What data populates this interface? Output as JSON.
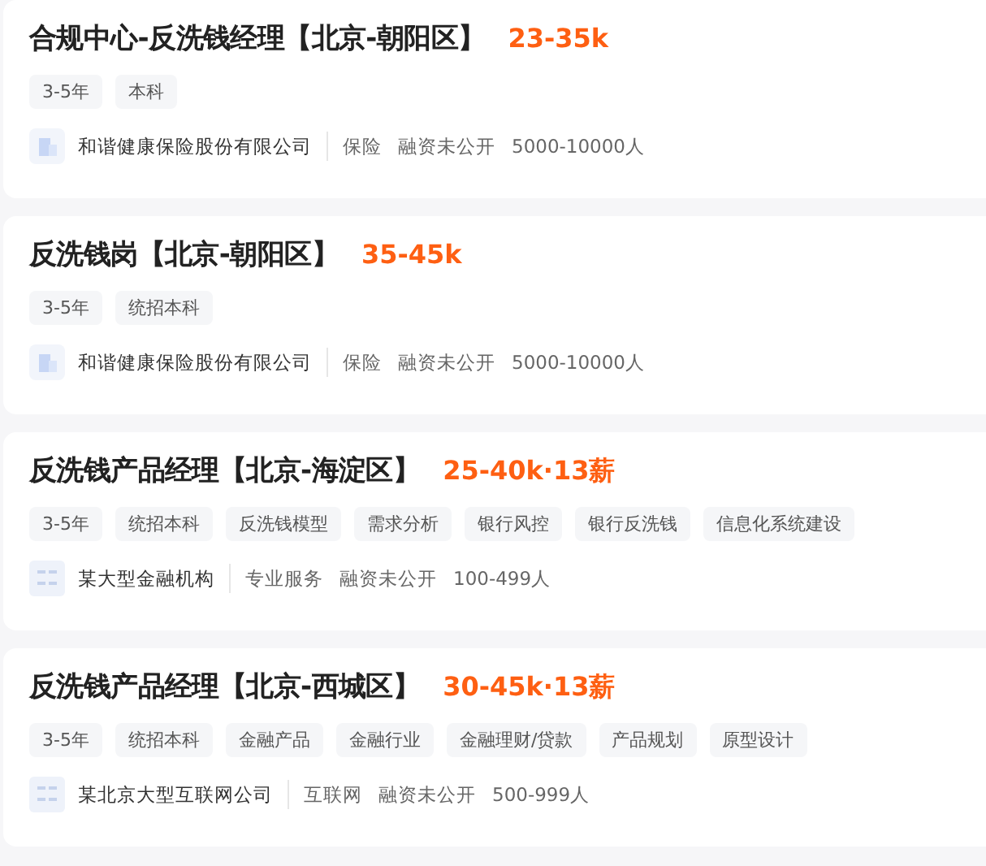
{
  "jobs": [
    {
      "title": "合规中心-反洗钱经理【北京-朝阳区】",
      "salary": "23-35k",
      "tags": [
        "3-5年",
        "本科"
      ],
      "company": {
        "logo": {
          "kind": "building"
        },
        "name": "和谐健康保险股份有限公司",
        "info": [
          "保险",
          "融资未公开",
          "5000-10000人"
        ]
      }
    },
    {
      "title": "反洗钱岗【北京-朝阳区】",
      "salary": "35-45k",
      "tags": [
        "3-5年",
        "统招本科"
      ],
      "company": {
        "logo": {
          "kind": "building"
        },
        "name": "和谐健康保险股份有限公司",
        "info": [
          "保险",
          "融资未公开",
          "5000-10000人"
        ]
      }
    },
    {
      "title": "反洗钱产品经理【北京-海淀区】",
      "salary": "25-40k·13薪",
      "tags": [
        "3-5年",
        "统招本科",
        "反洗钱模型",
        "需求分析",
        "银行风控",
        "银行反洗钱",
        "信息化系统建设"
      ],
      "company": {
        "logo": {
          "kind": "placeholder"
        },
        "name": "某大型金融机构",
        "info": [
          "专业服务",
          "融资未公开",
          "100-499人"
        ]
      }
    },
    {
      "title": "反洗钱产品经理【北京-西城区】",
      "salary": "30-45k·13薪",
      "tags": [
        "3-5年",
        "统招本科",
        "金融产品",
        "金融行业",
        "金融理财/贷款",
        "产品规划",
        "原型设计"
      ],
      "company": {
        "logo": {
          "kind": "placeholder"
        },
        "name": "某北京大型互联网公司",
        "info": [
          "互联网",
          "融资未公开",
          "500-999人"
        ]
      }
    }
  ]
}
